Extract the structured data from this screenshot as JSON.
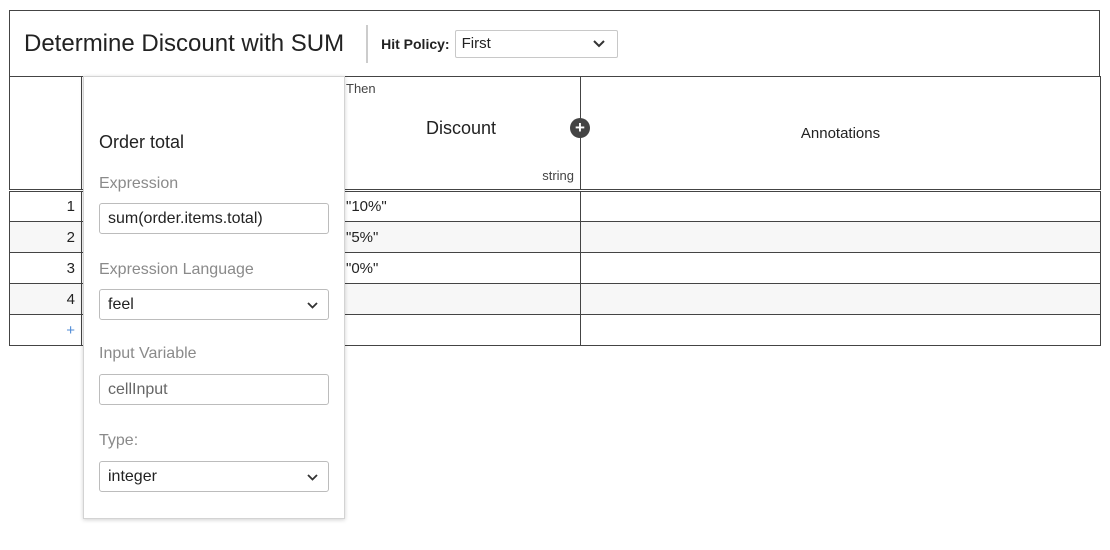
{
  "decision": {
    "title": "Determine Discount with SUM",
    "hit_policy_label": "Hit Policy:",
    "hit_policy_value": "First"
  },
  "table": {
    "then_label": "Then",
    "output_column": {
      "name": "Discount",
      "type": "string"
    },
    "annotations_label": "Annotations",
    "rows": [
      {
        "index": "1",
        "output": "\"10%\""
      },
      {
        "index": "2",
        "output": "\"5%\""
      },
      {
        "index": "3",
        "output": "\"0%\""
      },
      {
        "index": "4",
        "output": ""
      }
    ],
    "add_row_symbol": "+"
  },
  "input_popup": {
    "title": "Order total",
    "expression_label": "Expression",
    "expression_value": "sum(order.items.total)",
    "language_label": "Expression Language",
    "language_value": "feel",
    "input_variable_label": "Input Variable",
    "input_variable_placeholder": "cellInput",
    "type_label": "Type:",
    "type_value": "integer"
  },
  "icons": {
    "add_output": "plus-circle-icon",
    "dropdown": "chevron-down-icon"
  }
}
